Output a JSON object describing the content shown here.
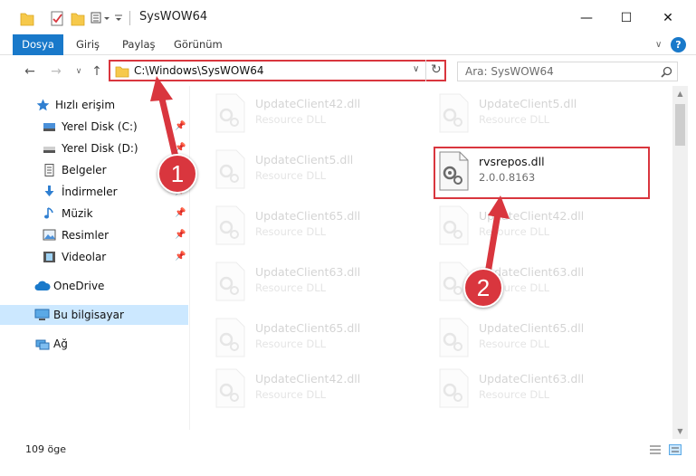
{
  "window": {
    "title": "SysWOW64",
    "minimize_glyph": "—",
    "maximize_glyph": "☐",
    "close_glyph": "✕"
  },
  "ribbon": {
    "tabs": [
      {
        "label": "Dosya"
      },
      {
        "label": "Giriş"
      },
      {
        "label": "Paylaş"
      },
      {
        "label": "Görünüm"
      }
    ],
    "help_glyph": "?",
    "collapse_glyph": "∨"
  },
  "address": {
    "path": "C:\\Windows\\SysWOW64",
    "back_glyph": "←",
    "forward_glyph": "→",
    "dropdown_glyph": "∨",
    "up_glyph": "↑",
    "refresh_glyph": "↻"
  },
  "search": {
    "placeholder": "Ara: SysWOW64",
    "icon": "search-icon"
  },
  "navpane": {
    "items": [
      {
        "label": "Hızlı erişim",
        "icon": "star-icon"
      },
      {
        "label": "Yerel Disk (C:)",
        "icon": "drive-icon"
      },
      {
        "label": "Yerel Disk (D:)",
        "icon": "drive-icon"
      },
      {
        "label": "Belgeler",
        "icon": "document-icon"
      },
      {
        "label": "İndirmeler",
        "icon": "download-icon"
      },
      {
        "label": "Müzik",
        "icon": "music-icon"
      },
      {
        "label": "Resimler",
        "icon": "pictures-icon"
      },
      {
        "label": "Videolar",
        "icon": "video-icon"
      },
      {
        "label": "OneDrive",
        "icon": "cloud-icon"
      },
      {
        "label": "Bu bilgisayar",
        "icon": "computer-icon"
      },
      {
        "label": "Ağ",
        "icon": "network-icon"
      }
    ],
    "pin_glyph": "📌"
  },
  "files": {
    "left": [
      {
        "name": "UpdateClient42.dll",
        "desc": "Resource DLL"
      },
      {
        "name": "UpdateClient5.dll",
        "desc": "Resource DLL"
      },
      {
        "name": "UpdateClient65.dll",
        "desc": "Resource DLL"
      },
      {
        "name": "UpdateClient63.dll",
        "desc": "Resource DLL"
      },
      {
        "name": "UpdateClient65.dll",
        "desc": "Resource DLL"
      },
      {
        "name": "UpdateClient42.dll",
        "desc": "Resource DLL"
      }
    ],
    "right": [
      {
        "name": "UpdateClient5.dll",
        "desc": "Resource DLL"
      },
      {
        "name": "UpdateClient42.dll",
        "desc": "Resource DLL"
      },
      {
        "name": "UpdateClient63.dll",
        "desc": "Resource DLL"
      },
      {
        "name": "UpdateClient65.dll",
        "desc": "Resource DLL"
      },
      {
        "name": "UpdateClient63.dll",
        "desc": "Resource DLL"
      }
    ],
    "highlighted": {
      "name": "rvsrepos.dll",
      "desc": "2.0.0.8163"
    }
  },
  "status": {
    "item_count": "109 öge"
  },
  "annotations": [
    {
      "label": "1"
    },
    {
      "label": "2"
    }
  ],
  "colors": {
    "accent": "#1979ca",
    "highlight_red": "#d9363e",
    "selection": "#cce8ff"
  }
}
